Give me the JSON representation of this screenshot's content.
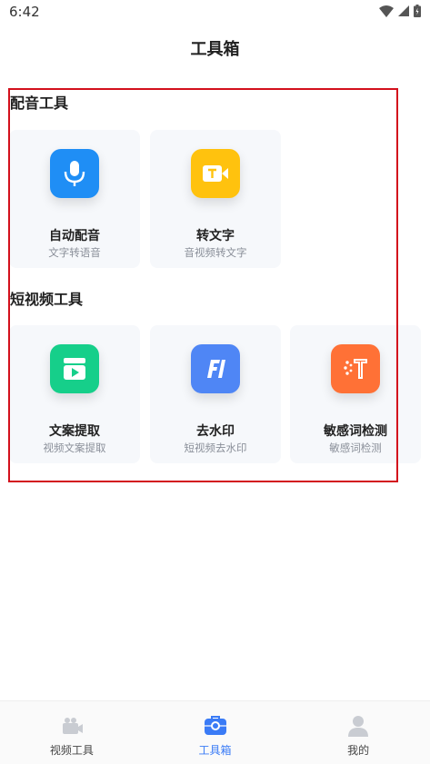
{
  "status": {
    "time": "6:42"
  },
  "header": {
    "title": "工具箱"
  },
  "sections": [
    {
      "title": "配音工具",
      "tools": [
        {
          "label": "自动配音",
          "sub": "文字转语音",
          "icon": "microphone-icon",
          "color": "#1f8ef5"
        },
        {
          "label": "转文字",
          "sub": "音视频转文字",
          "icon": "video-text-icon",
          "color": "#ffc20e"
        }
      ]
    },
    {
      "title": "短视频工具",
      "tools": [
        {
          "label": "文案提取",
          "sub": "视频文案提取",
          "icon": "video-copy-icon",
          "color": "#16cf8a"
        },
        {
          "label": "去水印",
          "sub": "短视频去水印",
          "icon": "watermark-icon",
          "color": "#4f86f5"
        },
        {
          "label": "敏感词检测",
          "sub": "敏感词检测",
          "icon": "sensitive-text-icon",
          "color": "#ff7136"
        }
      ]
    }
  ],
  "bottom_nav": [
    {
      "label": "视频工具",
      "icon": "video-camera-icon",
      "active": false
    },
    {
      "label": "工具箱",
      "icon": "toolbox-icon",
      "active": true
    },
    {
      "label": "我的",
      "icon": "user-icon",
      "active": false
    }
  ],
  "colors": {
    "accent": "#3a7bf6",
    "highlight_border": "#d3101c"
  }
}
